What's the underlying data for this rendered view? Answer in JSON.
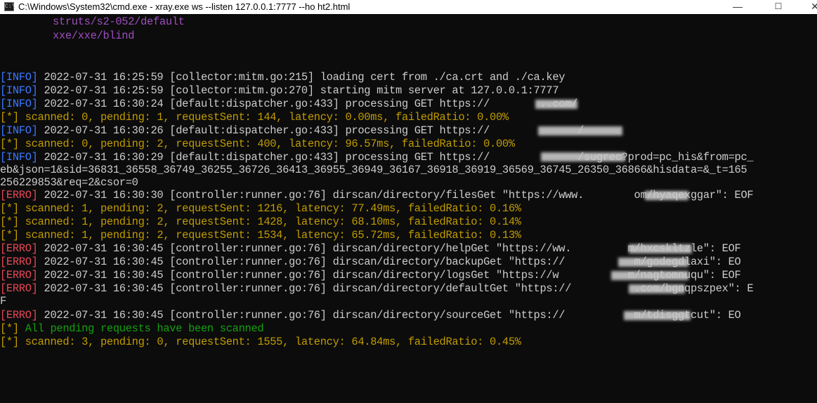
{
  "window": {
    "title": "C:\\Windows\\System32\\cmd.exe - xray.exe  ws --listen 127.0.0.1:7777 --ho ht2.html",
    "icon": "cmd-icon",
    "minimize_label": "—",
    "maximize_label": "☐",
    "close_label": "✕"
  },
  "colors": {
    "background": "#0c0c0c",
    "info": "#3b78ff",
    "error": "#e74856",
    "star": "#c19c00",
    "success": "#13a10e",
    "plugin": "#9e4dbe",
    "text": "#cccccc"
  },
  "console": {
    "plugins": [
      "struts/s2-052/default",
      "xxe/xxe/blind"
    ],
    "lines": [
      {
        "tag": "[INFO]",
        "text": " 2022-07-31 16:25:59 [collector:mitm.go:215] loading cert from ./ca.crt and ./ca.key"
      },
      {
        "tag": "[INFO]",
        "text": " 2022-07-31 16:25:59 [collector:mitm.go:270] starting mitm server at 127.0.0.1:7777"
      },
      {
        "tag": "[INFO]",
        "text": " 2022-07-31 16:30:24 [default:dispatcher.go:433] processing GET https://        ..com/"
      },
      {
        "tag": "[*]",
        "text": " scanned: 0, pending: 1, requestSent: 144, latency: 0.00ms, failedRatio: 0.00%"
      },
      {
        "tag": "[INFO]",
        "text": " 2022-07-31 16:30:26 [default:dispatcher.go:433] processing GET https://              /"
      },
      {
        "tag": "[*]",
        "text": " scanned: 0, pending: 2, requestSent: 400, latency: 96.57ms, failedRatio: 0.00%"
      },
      {
        "tag": "[INFO]",
        "text": " 2022-07-31 16:30:29 [default:dispatcher.go:433] processing GET https://              /sugrec?prod=pc_his&from=pc_"
      },
      {
        "tag": "",
        "text": "eb&json=1&sid=36831_36558_36749_36255_36726_36413_36955_36949_36167_36918_36919_36569_36745_26350_36866&hisdata=&_t=165"
      },
      {
        "tag": "",
        "text": "256229853&req=2&csor=0"
      },
      {
        "tag": "[ERRO]",
        "text": " 2022-07-31 16:30:30 [controller:runner.go:76] dirscan/directory/filesGet \"https://www.        om/hyaqexggar\": EOF"
      },
      {
        "tag": "[*]",
        "text": " scanned: 1, pending: 2, requestSent: 1216, latency: 77.49ms, failedRatio: 0.16%"
      },
      {
        "tag": "[*]",
        "text": " scanned: 1, pending: 2, requestSent: 1428, latency: 68.10ms, failedRatio: 0.14%"
      },
      {
        "tag": "[*]",
        "text": " scanned: 1, pending: 2, requestSent: 1534, latency: 65.72ms, failedRatio: 0.13%"
      },
      {
        "tag": "[ERRO]",
        "text": " 2022-07-31 16:30:45 [controller:runner.go:76] dirscan/directory/helpGet \"https://ww.         m/hxcskltzle\": EOF"
      },
      {
        "tag": "[ERRO]",
        "text": " 2022-07-31 16:30:45 [controller:runner.go:76] dirscan/directory/backupGet \"https://           m/godegdlaxi\": EO"
      },
      {
        "tag": "[ERRO]",
        "text": " 2022-07-31 16:30:45 [controller:runner.go:76] dirscan/directory/logsGet \"https://w           m/nagtomnuqu\": EOF"
      },
      {
        "tag": "[ERRO]",
        "text": " 2022-07-31 16:30:45 [controller:runner.go:76] dirscan/directory/defaultGet \"https://          .com/bgnqpszpex\": E"
      },
      {
        "tag": "",
        "text": "F"
      },
      {
        "tag": "[ERRO]",
        "text": " 2022-07-31 16:30:45 [controller:runner.go:76] dirscan/directory/sourceGet \"https://           m/tdisggtcut\": EO"
      },
      {
        "tag": "[*]",
        "text": " All pending requests have been scanned"
      },
      {
        "tag": "[*]",
        "text": " scanned: 3, pending: 0, requestSent: 1555, latency: 64.84ms, failedRatio: 0.45%"
      }
    ]
  }
}
